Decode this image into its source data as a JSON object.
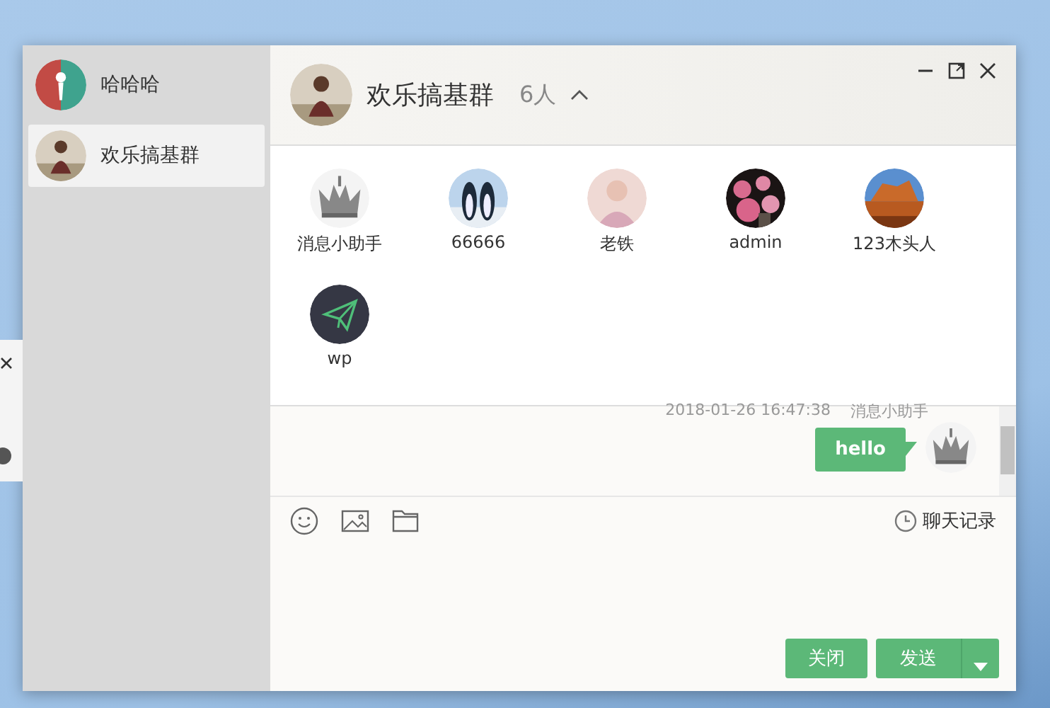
{
  "sidebar": {
    "profile": {
      "name": "哈哈哈"
    },
    "chats": [
      {
        "name": "欢乐搞基群",
        "selected": true
      }
    ]
  },
  "chat": {
    "title": "欢乐搞基群",
    "member_count": "6人",
    "members_expanded": true,
    "members": [
      {
        "name": "消息小助手",
        "kind": "crown"
      },
      {
        "name": "66666",
        "kind": "penguins"
      },
      {
        "name": "老铁",
        "kind": "person"
      },
      {
        "name": "admin",
        "kind": "flowers"
      },
      {
        "name": "123木头人",
        "kind": "canyon"
      },
      {
        "name": "wp",
        "kind": "plane"
      }
    ],
    "messages": [
      {
        "time": "2018-01-26 16:47:38",
        "sender": "消息小助手",
        "text": "hello",
        "kind": "crown"
      }
    ],
    "history_label": "聊天记录",
    "buttons": {
      "close": "关闭",
      "send": "发送"
    }
  }
}
